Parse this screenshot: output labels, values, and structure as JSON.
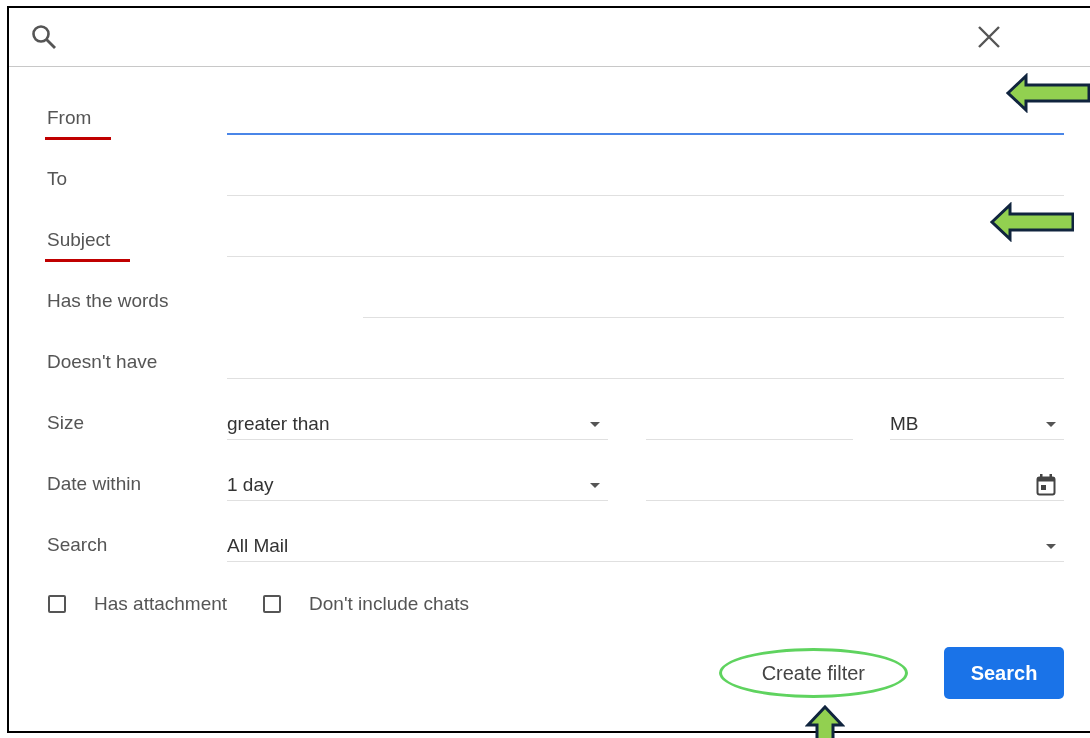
{
  "fields": [
    {
      "label": "From",
      "kind": "text",
      "focused": true,
      "underlined": true,
      "arrow": true,
      "short_field": false
    },
    {
      "label": "To",
      "kind": "text",
      "focused": false,
      "underlined": false,
      "arrow": false,
      "short_field": false
    },
    {
      "label": "Subject",
      "kind": "text",
      "focused": false,
      "underlined": true,
      "arrow": true,
      "short_field": false
    },
    {
      "label": "Has the words",
      "kind": "text",
      "focused": false,
      "underlined": false,
      "arrow": false,
      "short_field": true
    },
    {
      "label": "Doesn't have",
      "kind": "text",
      "focused": false,
      "underlined": false,
      "arrow": false,
      "short_field": false
    },
    {
      "label": "Size",
      "kind": "size",
      "operator": "greater than",
      "unit": "MB"
    },
    {
      "label": "Date within",
      "kind": "date",
      "value": "1 day"
    },
    {
      "label": "Search",
      "kind": "select",
      "value": "All Mail"
    }
  ],
  "checkboxes": [
    {
      "label": "Has attachment",
      "checked": false
    },
    {
      "label": "Don't include chats",
      "checked": false
    }
  ],
  "buttons": [
    {
      "label": "Create filter",
      "kind": "text",
      "circled": true
    },
    {
      "label": "Search",
      "kind": "primary",
      "circled": false
    }
  ]
}
